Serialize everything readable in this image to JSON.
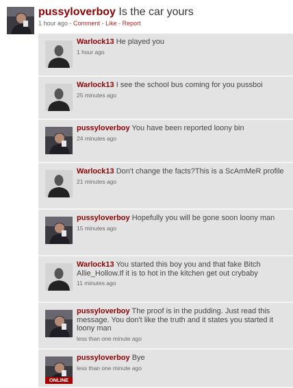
{
  "post": {
    "username": "pussyloverboy",
    "text": "Is the car yours",
    "time": "1 hour ago",
    "sep1": " - ",
    "comment": "Comment",
    "sep2": " - ",
    "like": "Like",
    "sep3": " - ",
    "report": "Report"
  },
  "replies": [
    {
      "username": "Warlock13",
      "text": "He played you",
      "time": "1 hour ago",
      "avatar": "default-silhouette"
    },
    {
      "username": "Warlock13",
      "text": "I see the school bus coming for you pussboi",
      "time": "25 minutes ago",
      "avatar": "default-silhouette"
    },
    {
      "username": "pussyloverboy",
      "text": "You have been reported loony bin",
      "time": "24 minutes ago",
      "avatar": "user-photo"
    },
    {
      "username": "Warlock13",
      "text": "Don't change the facts?This is a ScAmMeR profile",
      "time": "21 minutes ago",
      "avatar": "default-silhouette"
    },
    {
      "username": "pussyloverboy",
      "text": "Hopefully you will be gone soon loony man",
      "time": "15 minutes ago",
      "avatar": "user-photo"
    },
    {
      "username": "Warlock13",
      "text": "You started this boy you and that fake Bitch Allie_Hollow.If it is to hot in the kitchen get out crybaby",
      "time": "11 minutes ago",
      "avatar": "default-silhouette"
    },
    {
      "username": "pussyloverboy",
      "text": "The proof is in the pudding. Just read this message. You don't like the truth and it states you started it loony man",
      "time": "less than one minute ago",
      "avatar": "user-photo"
    },
    {
      "username": "pussyloverboy",
      "text": "Bye",
      "time": "less than one minute ago",
      "avatar": "user-photo",
      "badge": "ONLINE"
    }
  ]
}
